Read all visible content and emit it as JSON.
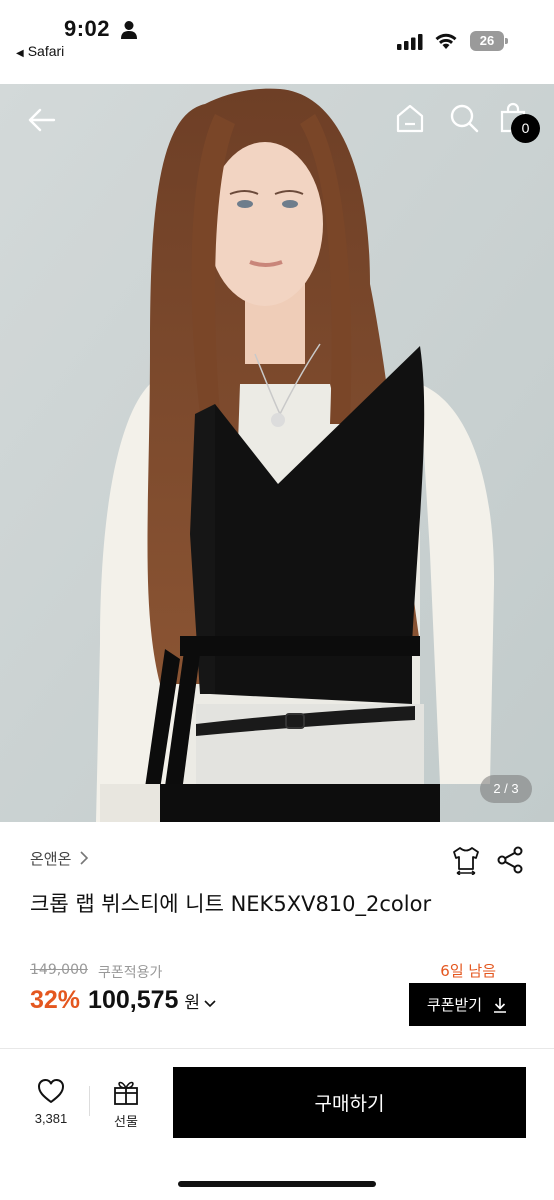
{
  "status_bar": {
    "time": "9:02",
    "back_app": "Safari",
    "battery": "26"
  },
  "gallery": {
    "page_indicator": "2 / 3",
    "cart_count": "0"
  },
  "product": {
    "brand": "온앤온",
    "title": "크롭 랩 뷔스티에 니트 NEK5XV810_2color",
    "original_price": "149,000",
    "coupon_label": "쿠폰적용가",
    "days_left": "6일 남음",
    "discount": "32%",
    "sale_price": "100,575",
    "currency": "원",
    "coupon_button": "쿠폰받기"
  },
  "bottom_bar": {
    "like_count": "3,381",
    "gift_label": "선물",
    "buy_label": "구매하기"
  },
  "colors": {
    "accent": "#e4571f",
    "primary": "#000000"
  }
}
